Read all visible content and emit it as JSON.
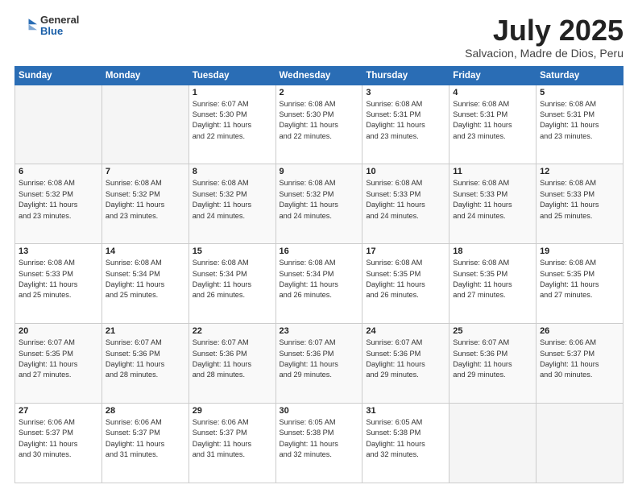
{
  "logo": {
    "general": "General",
    "blue": "Blue"
  },
  "header": {
    "month": "July 2025",
    "location": "Salvacion, Madre de Dios, Peru"
  },
  "weekdays": [
    "Sunday",
    "Monday",
    "Tuesday",
    "Wednesday",
    "Thursday",
    "Friday",
    "Saturday"
  ],
  "weeks": [
    [
      {
        "day": "",
        "info": ""
      },
      {
        "day": "",
        "info": ""
      },
      {
        "day": "1",
        "info": "Sunrise: 6:07 AM\nSunset: 5:30 PM\nDaylight: 11 hours\nand 22 minutes."
      },
      {
        "day": "2",
        "info": "Sunrise: 6:08 AM\nSunset: 5:30 PM\nDaylight: 11 hours\nand 22 minutes."
      },
      {
        "day": "3",
        "info": "Sunrise: 6:08 AM\nSunset: 5:31 PM\nDaylight: 11 hours\nand 23 minutes."
      },
      {
        "day": "4",
        "info": "Sunrise: 6:08 AM\nSunset: 5:31 PM\nDaylight: 11 hours\nand 23 minutes."
      },
      {
        "day": "5",
        "info": "Sunrise: 6:08 AM\nSunset: 5:31 PM\nDaylight: 11 hours\nand 23 minutes."
      }
    ],
    [
      {
        "day": "6",
        "info": "Sunrise: 6:08 AM\nSunset: 5:32 PM\nDaylight: 11 hours\nand 23 minutes."
      },
      {
        "day": "7",
        "info": "Sunrise: 6:08 AM\nSunset: 5:32 PM\nDaylight: 11 hours\nand 23 minutes."
      },
      {
        "day": "8",
        "info": "Sunrise: 6:08 AM\nSunset: 5:32 PM\nDaylight: 11 hours\nand 24 minutes."
      },
      {
        "day": "9",
        "info": "Sunrise: 6:08 AM\nSunset: 5:32 PM\nDaylight: 11 hours\nand 24 minutes."
      },
      {
        "day": "10",
        "info": "Sunrise: 6:08 AM\nSunset: 5:33 PM\nDaylight: 11 hours\nand 24 minutes."
      },
      {
        "day": "11",
        "info": "Sunrise: 6:08 AM\nSunset: 5:33 PM\nDaylight: 11 hours\nand 24 minutes."
      },
      {
        "day": "12",
        "info": "Sunrise: 6:08 AM\nSunset: 5:33 PM\nDaylight: 11 hours\nand 25 minutes."
      }
    ],
    [
      {
        "day": "13",
        "info": "Sunrise: 6:08 AM\nSunset: 5:33 PM\nDaylight: 11 hours\nand 25 minutes."
      },
      {
        "day": "14",
        "info": "Sunrise: 6:08 AM\nSunset: 5:34 PM\nDaylight: 11 hours\nand 25 minutes."
      },
      {
        "day": "15",
        "info": "Sunrise: 6:08 AM\nSunset: 5:34 PM\nDaylight: 11 hours\nand 26 minutes."
      },
      {
        "day": "16",
        "info": "Sunrise: 6:08 AM\nSunset: 5:34 PM\nDaylight: 11 hours\nand 26 minutes."
      },
      {
        "day": "17",
        "info": "Sunrise: 6:08 AM\nSunset: 5:35 PM\nDaylight: 11 hours\nand 26 minutes."
      },
      {
        "day": "18",
        "info": "Sunrise: 6:08 AM\nSunset: 5:35 PM\nDaylight: 11 hours\nand 27 minutes."
      },
      {
        "day": "19",
        "info": "Sunrise: 6:08 AM\nSunset: 5:35 PM\nDaylight: 11 hours\nand 27 minutes."
      }
    ],
    [
      {
        "day": "20",
        "info": "Sunrise: 6:07 AM\nSunset: 5:35 PM\nDaylight: 11 hours\nand 27 minutes."
      },
      {
        "day": "21",
        "info": "Sunrise: 6:07 AM\nSunset: 5:36 PM\nDaylight: 11 hours\nand 28 minutes."
      },
      {
        "day": "22",
        "info": "Sunrise: 6:07 AM\nSunset: 5:36 PM\nDaylight: 11 hours\nand 28 minutes."
      },
      {
        "day": "23",
        "info": "Sunrise: 6:07 AM\nSunset: 5:36 PM\nDaylight: 11 hours\nand 29 minutes."
      },
      {
        "day": "24",
        "info": "Sunrise: 6:07 AM\nSunset: 5:36 PM\nDaylight: 11 hours\nand 29 minutes."
      },
      {
        "day": "25",
        "info": "Sunrise: 6:07 AM\nSunset: 5:36 PM\nDaylight: 11 hours\nand 29 minutes."
      },
      {
        "day": "26",
        "info": "Sunrise: 6:06 AM\nSunset: 5:37 PM\nDaylight: 11 hours\nand 30 minutes."
      }
    ],
    [
      {
        "day": "27",
        "info": "Sunrise: 6:06 AM\nSunset: 5:37 PM\nDaylight: 11 hours\nand 30 minutes."
      },
      {
        "day": "28",
        "info": "Sunrise: 6:06 AM\nSunset: 5:37 PM\nDaylight: 11 hours\nand 31 minutes."
      },
      {
        "day": "29",
        "info": "Sunrise: 6:06 AM\nSunset: 5:37 PM\nDaylight: 11 hours\nand 31 minutes."
      },
      {
        "day": "30",
        "info": "Sunrise: 6:05 AM\nSunset: 5:38 PM\nDaylight: 11 hours\nand 32 minutes."
      },
      {
        "day": "31",
        "info": "Sunrise: 6:05 AM\nSunset: 5:38 PM\nDaylight: 11 hours\nand 32 minutes."
      },
      {
        "day": "",
        "info": ""
      },
      {
        "day": "",
        "info": ""
      }
    ]
  ]
}
